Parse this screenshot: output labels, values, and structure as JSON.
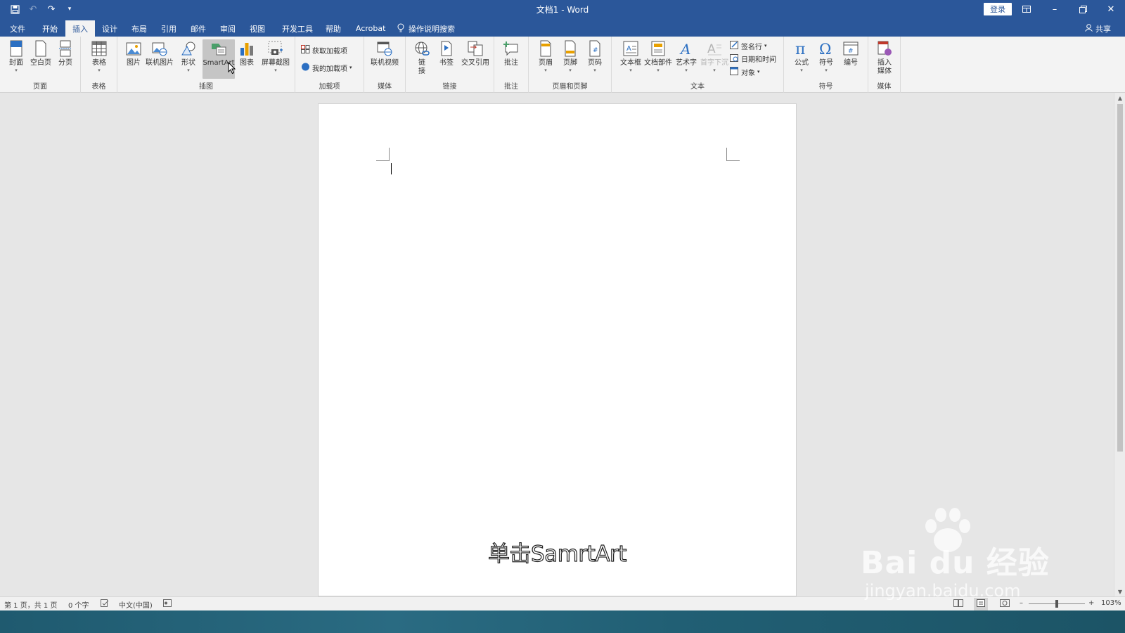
{
  "window": {
    "title": "文档1 - Word",
    "login_label": "登录",
    "share_label": "共享"
  },
  "tabs": [
    "文件",
    "开始",
    "插入",
    "设计",
    "布局",
    "引用",
    "邮件",
    "审阅",
    "视图",
    "开发工具",
    "帮助",
    "Acrobat"
  ],
  "active_tab": "插入",
  "tell_me": "操作说明搜索",
  "ribbon": {
    "groups": {
      "pages": "页面",
      "tables": "表格",
      "illustrations": "插图",
      "addins": "加载项",
      "media": "媒体",
      "links": "链接",
      "comments": "批注",
      "header_footer": "页眉和页脚",
      "text": "文本",
      "symbols": "符号",
      "media2": "媒体"
    },
    "buttons": {
      "cover": "封面",
      "blank_page": "空白页",
      "page_break": "分页",
      "table": "表格",
      "pictures": "图片",
      "online_pictures": "联机图片",
      "shapes": "形状",
      "smartart": "SmartArt",
      "chart": "图表",
      "screenshot": "屏幕截图",
      "get_addins": "获取加载项",
      "my_addins": "我的加载项",
      "online_video": "联机视频",
      "link_1": "链",
      "link_2": "接",
      "bookmark": "书签",
      "cross_ref": "交叉引用",
      "comment": "批注",
      "header": "页眉",
      "footer": "页脚",
      "page_number": "页码",
      "textbox": "文本框",
      "quick_parts": "文档部件",
      "wordart": "艺术字",
      "dropcap": "首字下沉",
      "signature_line": "签名行",
      "date_time": "日期和时间",
      "object": "对象",
      "equation": "公式",
      "symbol": "符号",
      "numbering": "编号",
      "insert_media_1": "插入",
      "insert_media_2": "媒体"
    }
  },
  "document": {
    "annotation": "单击SamrtArt"
  },
  "status": {
    "page": "第 1 页，共 1 页",
    "words": "0 个字",
    "language": "中文(中国)",
    "zoom": "103%"
  },
  "watermark": {
    "brand": "Bai du 经验",
    "url": "jingyan.baidu.com"
  },
  "colors": {
    "title_bar": "#2b579a",
    "ribbon": "#f3f3f3",
    "canvas": "#e6e6e6"
  }
}
